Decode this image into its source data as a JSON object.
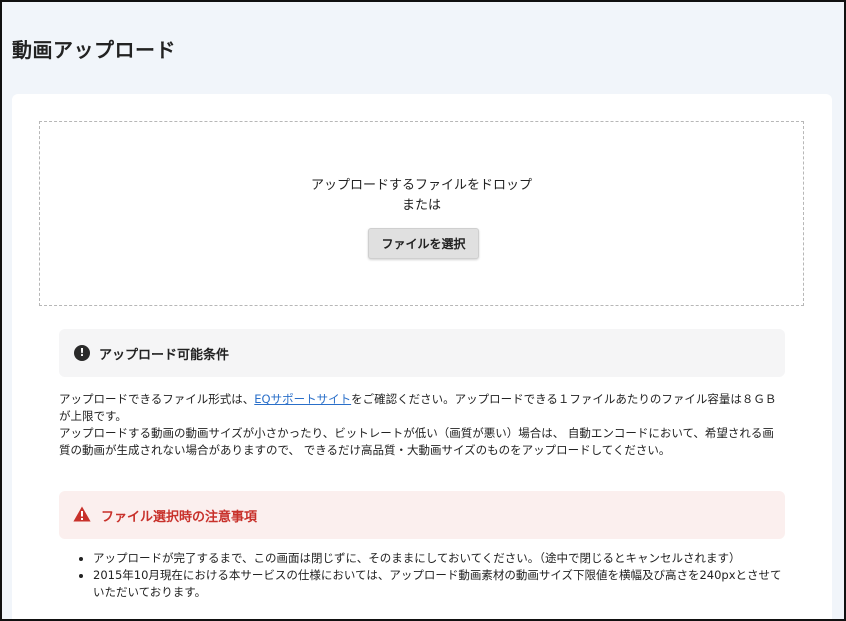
{
  "page": {
    "title": "動画アップロード"
  },
  "dropzone": {
    "line1": "アップロードするファイルをドロップ",
    "line2": "または",
    "select_button_label": "ファイルを選択"
  },
  "conditions": {
    "icon": "exclamation-circle-icon",
    "title": "アップロード可能条件",
    "p1_before_link": "アップロードできるファイル形式は、",
    "p1_link": "EQサポートサイト",
    "p1_after_link": "をご確認ください。アップロードできる１ファイルあたりのファイル容量は８ＧＢが上限です。",
    "p2": "アップロードする動画の動画サイズが小さかったり、ビットレートが低い（画質が悪い）場合は、 自動エンコードにおいて、希望される画質の動画が生成されない場合がありますので、 できるだけ高品質・大動画サイズのものをアップロードしてください。"
  },
  "notice": {
    "icon": "warning-triangle-icon",
    "title": "ファイル選択時の注意事項",
    "items": [
      "アップロードが完了するまで、この画面は閉じずに、そのままにしておいてください。（途中で閉じるとキャンセルされます）",
      "2015年10月現在における本サービスの仕様においては、アップロード動画素材の動画サイズ下限値を横幅及び高さを240pxとさせていただいております。"
    ]
  },
  "colors": {
    "page_background": "#f1f5fa",
    "link": "#2a6fc9",
    "warning": "#c8312b",
    "warning_background": "#fbefee"
  }
}
